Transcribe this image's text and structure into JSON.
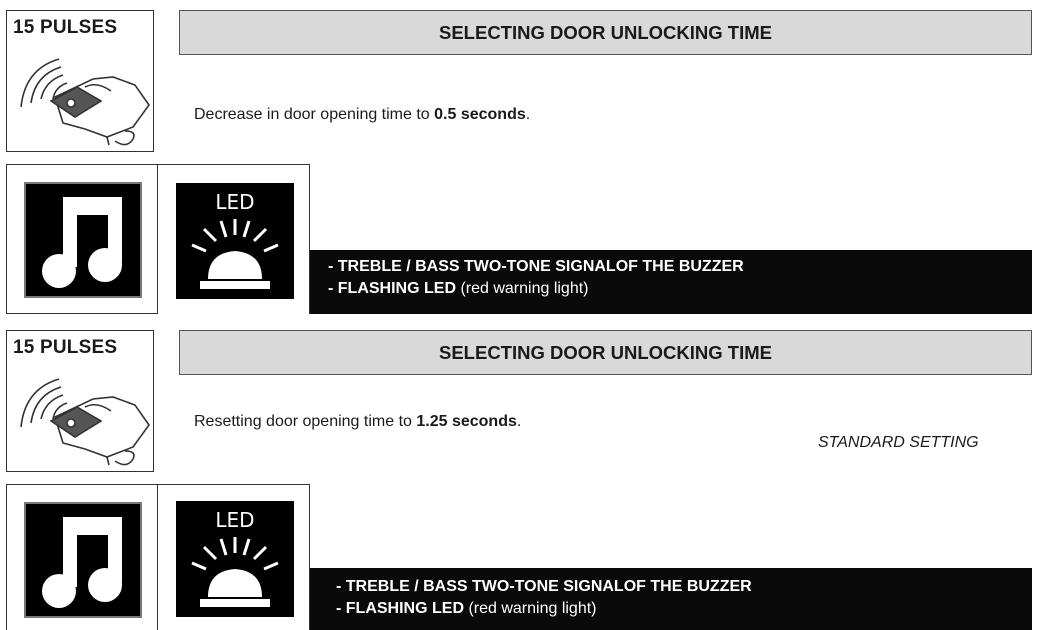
{
  "sections": [
    {
      "pulses": "15 PULSES",
      "header": "SELECTING DOOR UNLOCKING TIME",
      "desc_text": "Decrease in door opening time to ",
      "desc_bold": "0.5 seconds",
      "desc_end": ".",
      "standard": "",
      "led_label": "LED",
      "signal_line1": "- TREBLE / BASS TWO-TONE SIGNALOF THE BUZZER",
      "signal_line2_bold": "- FLASHING LED",
      "signal_line2_rest": " (red warning light)"
    },
    {
      "pulses": "15 PULSES",
      "header": "SELECTING DOOR UNLOCKING TIME",
      "desc_text": "Resetting door opening time to ",
      "desc_bold": "1.25 seconds",
      "desc_end": ".",
      "standard": "STANDARD SETTING",
      "led_label": "LED",
      "signal_line1": "- TREBLE / BASS TWO-TONE SIGNALOF THE BUZZER",
      "signal_line2_bold": "- FLASHING LED",
      "signal_line2_rest": " (red warning light)"
    }
  ],
  "icons": {
    "remote": "remote-control-hand-icon",
    "note": "music-note-icon",
    "led": "led-warning-light-icon"
  },
  "colors": {
    "header_bg": "#d9d9d9",
    "bar_bg": "#0a0a0a"
  }
}
